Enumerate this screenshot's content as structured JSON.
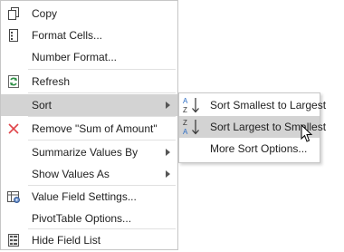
{
  "menu": {
    "items": [
      {
        "label": "Copy",
        "icon": "copy-icon"
      },
      {
        "label": "Format Cells...",
        "icon": "format-cells-icon"
      },
      {
        "label": "Number Format..."
      },
      {
        "label": "Refresh",
        "icon": "refresh-icon"
      },
      {
        "label": "Sort",
        "submenu": true,
        "highlighted": true
      },
      {
        "label": "Remove \"Sum of Amount\"",
        "icon": "remove-x-icon"
      },
      {
        "label": "Summarize Values By",
        "submenu": true
      },
      {
        "label": "Show Values As",
        "submenu": true
      },
      {
        "label": "Value Field Settings...",
        "icon": "value-field-settings-icon"
      },
      {
        "label": "PivotTable Options..."
      },
      {
        "label": "Hide Field List",
        "icon": "field-list-icon"
      }
    ]
  },
  "sort_submenu": {
    "items": [
      {
        "label": "Sort Smallest to Largest",
        "icon": "sort-a-to-z-icon"
      },
      {
        "label": "Sort Largest to Smallest",
        "icon": "sort-z-to-a-icon",
        "highlighted": true
      },
      {
        "label": "More Sort Options..."
      }
    ]
  },
  "colors": {
    "highlight": "#d3d3d3",
    "border": "#c6c6c6",
    "remove_red": "#e0454a",
    "refresh_green": "#2f8f46",
    "sort_blue": "#2b6cc4"
  },
  "icon_letters": {
    "a": "A",
    "z": "Z"
  }
}
